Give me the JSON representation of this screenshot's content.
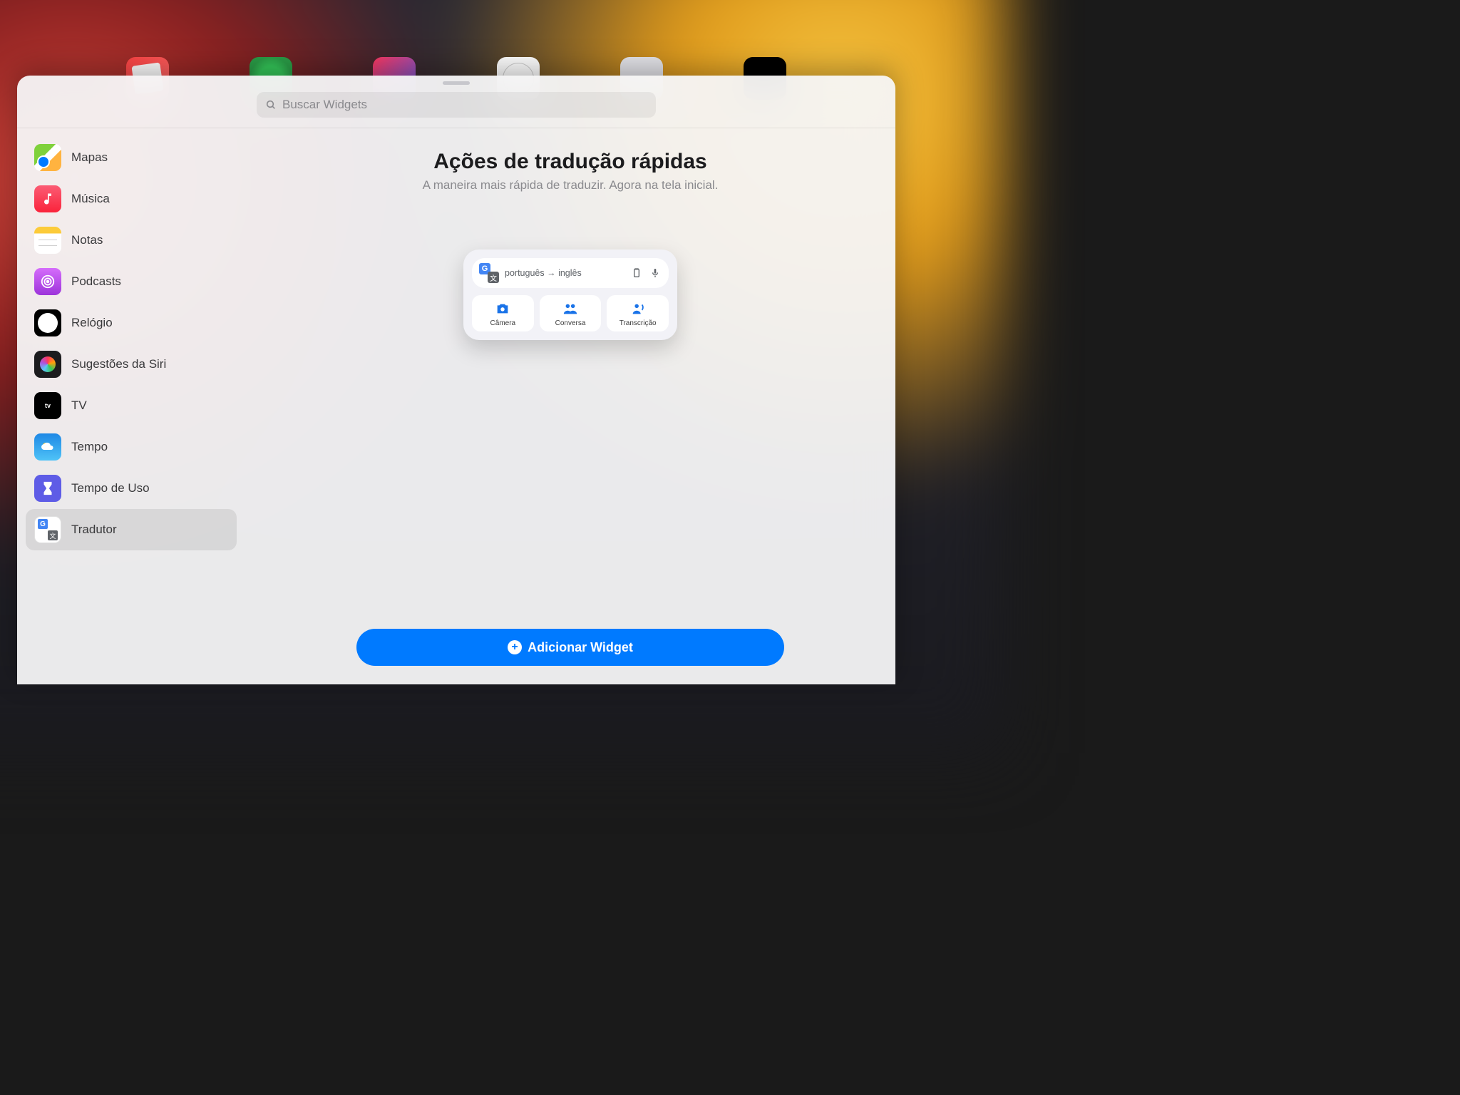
{
  "search": {
    "placeholder": "Buscar Widgets"
  },
  "sidebar": {
    "items": [
      {
        "label": "Mapas"
      },
      {
        "label": "Música"
      },
      {
        "label": "Notas"
      },
      {
        "label": "Podcasts"
      },
      {
        "label": "Relógio"
      },
      {
        "label": "Sugestões da Siri"
      },
      {
        "label": "TV"
      },
      {
        "label": "Tempo"
      },
      {
        "label": "Tempo de Uso"
      },
      {
        "label": "Tradutor",
        "selected": true
      }
    ]
  },
  "main": {
    "title": "Ações de tradução rápidas",
    "subtitle": "A maneira mais rápida de traduzir. Agora na tela inicial.",
    "add_button": "Adicionar Widget"
  },
  "widget_preview": {
    "lang_from": "português",
    "lang_to": "inglês",
    "actions": [
      {
        "label": "Câmera"
      },
      {
        "label": "Conversa"
      },
      {
        "label": "Transcrição"
      }
    ]
  },
  "tv_label": "tv"
}
